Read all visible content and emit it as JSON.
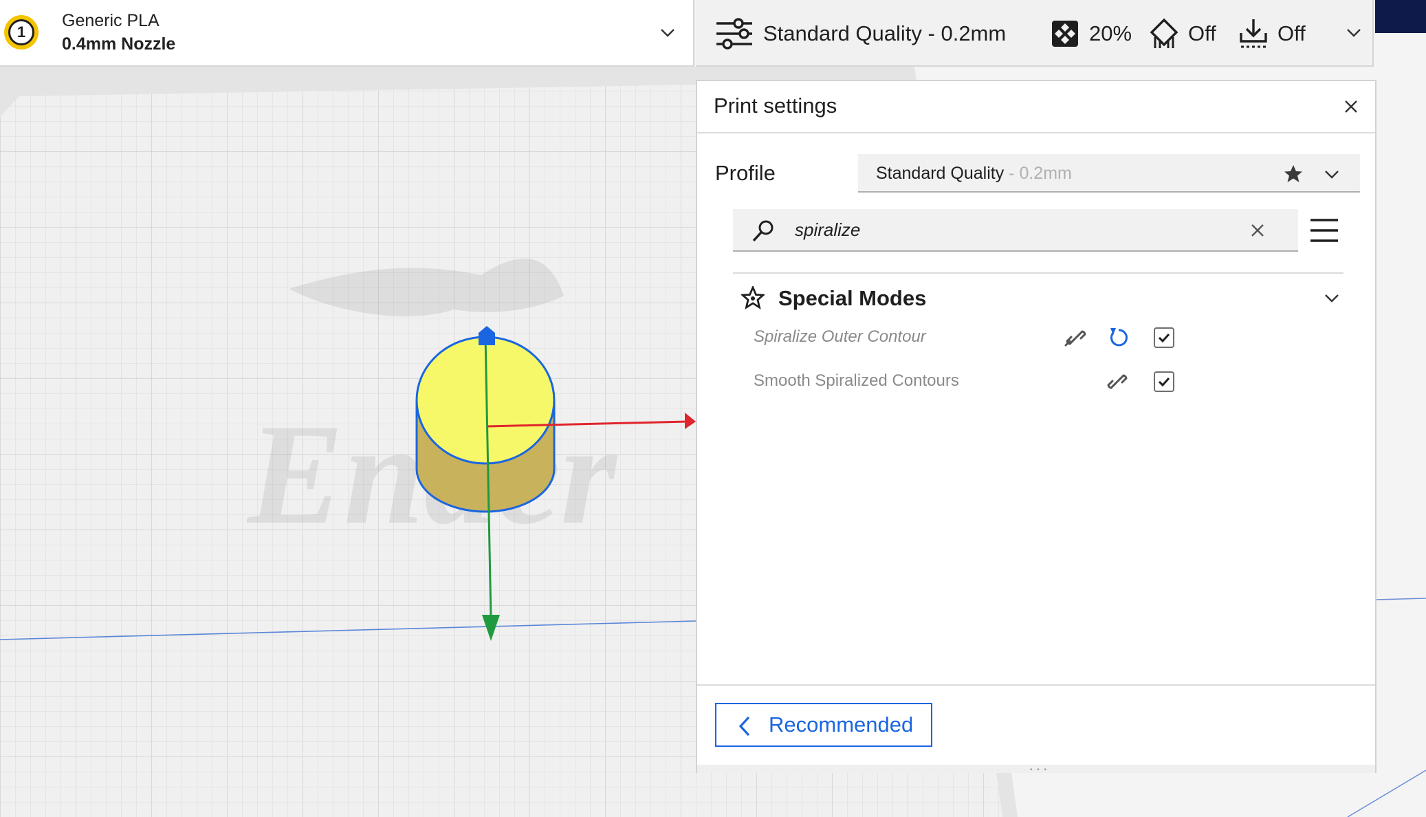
{
  "material_bar": {
    "extruder_number": "1",
    "material_name": "Generic PLA",
    "nozzle": "0.4mm Nozzle"
  },
  "settings_bar": {
    "profile_summary": "Standard Quality - 0.2mm",
    "infill": "20%",
    "support": "Off",
    "adhesion": "Off"
  },
  "panel": {
    "title": "Print settings",
    "profile_label": "Profile",
    "profile_name": "Standard Quality",
    "profile_separator": " - ",
    "profile_layer": "0.2mm",
    "search": {
      "value": "spiralize",
      "placeholder": ""
    },
    "category": {
      "label": "Special Modes",
      "expanded": true
    },
    "settings": [
      {
        "label": "Spiralize Outer Contour",
        "checked": true,
        "modified": true
      },
      {
        "label": "Smooth Spiralized Contours",
        "checked": true,
        "modified": false
      }
    ],
    "recommended_label": "Recommended"
  },
  "colors": {
    "accent_blue": "#1a66e0",
    "extruder_yellow": "#f5c400",
    "model_top": "#f7f76a",
    "model_side": "#c9b25c",
    "axis_x": "#e0242b",
    "axis_y": "#1f9a3e",
    "axis_z": "#1a66e0"
  },
  "icons": {
    "settings_bar": [
      "sliders-icon",
      "infill-icon",
      "support-icon",
      "adhesion-icon",
      "chevron-down-icon"
    ],
    "panel": [
      "close-icon",
      "star-icon",
      "search-icon",
      "clear-icon",
      "hamburger-menu-icon",
      "special-modes-star-icon",
      "link-icon",
      "reset-icon",
      "checkbox"
    ]
  }
}
